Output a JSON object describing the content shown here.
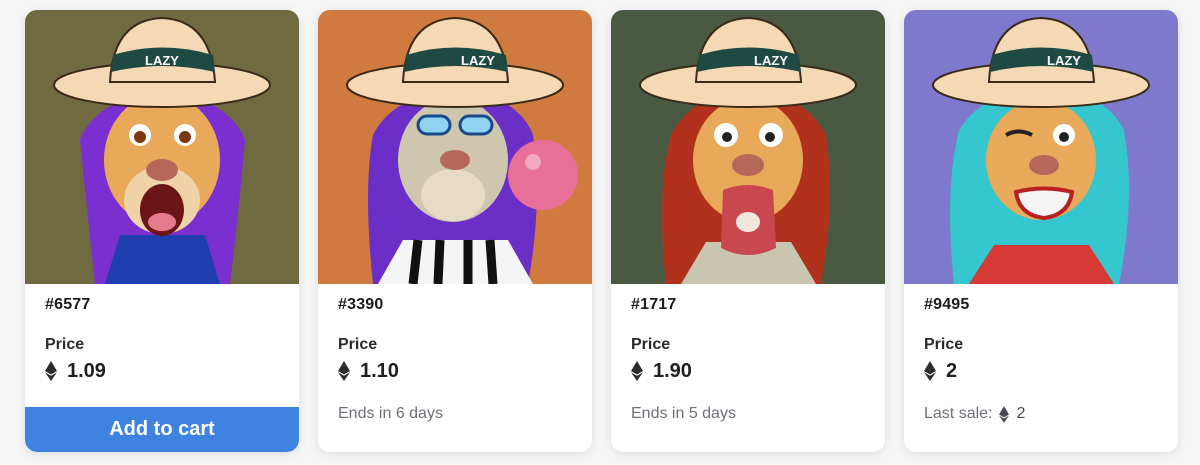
{
  "cards": [
    {
      "id": "#6577",
      "price_label": "Price",
      "price": "1.09",
      "cta": "Add to cart",
      "bg": "#6f6a3f",
      "mane": "#7b2fd0",
      "shirt": "#1f3fb0"
    },
    {
      "id": "#3390",
      "price_label": "Price",
      "price": "1.10",
      "sub": "Ends in 6 days",
      "bg": "#d07a3f",
      "mane": "#6b2fc7",
      "shirt": "#f4f4f4"
    },
    {
      "id": "#1717",
      "price_label": "Price",
      "price": "1.90",
      "sub": "Ends in 5 days",
      "bg": "#4a5a42",
      "mane": "#b0321c",
      "shirt": "#c9c6b0"
    },
    {
      "id": "#9495",
      "price_label": "Price",
      "price": "2",
      "sub_label": "Last sale:",
      "sub_value": "2",
      "bg": "#7e79cc",
      "mane": "#36c6cf",
      "shirt": "#d63a36"
    }
  ],
  "hat_text": "LAZY",
  "colors": {
    "accent": "#3f83e0",
    "hat": "#f5d9b4",
    "hat_band": "#1f4a44"
  },
  "icons": {
    "currency": "ethereum-icon"
  }
}
